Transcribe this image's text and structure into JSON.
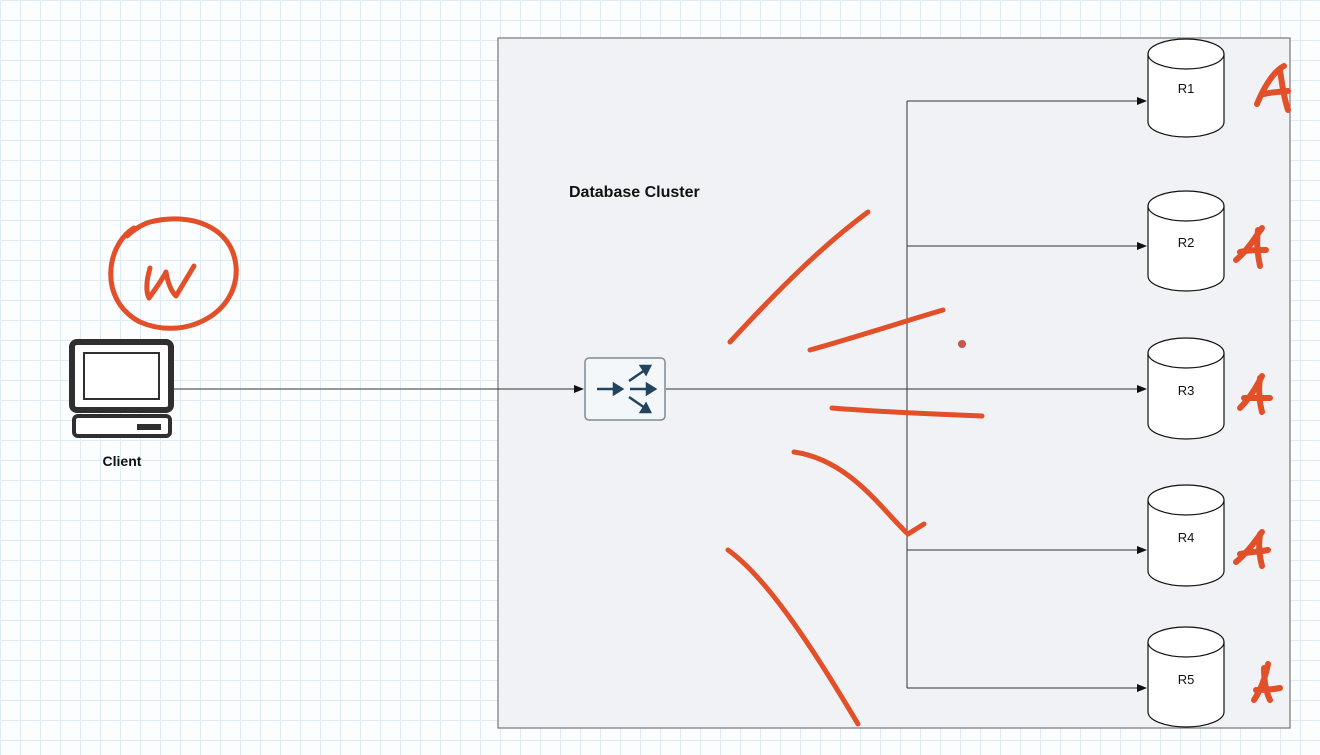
{
  "cluster": {
    "title": "Database Cluster"
  },
  "client": {
    "label": "Client",
    "icon": "desktop-computer-icon"
  },
  "router": {
    "icon": "load-balancer-icon"
  },
  "replicas": [
    {
      "label": "R1",
      "mark": "A"
    },
    {
      "label": "R2",
      "mark": "A"
    },
    {
      "label": "R3",
      "mark": "A"
    },
    {
      "label": "R4",
      "mark": "A"
    },
    {
      "label": "R5",
      "mark": "A"
    }
  ],
  "annotations": {
    "client_mark": "W",
    "ink_color": "#e2502a"
  }
}
